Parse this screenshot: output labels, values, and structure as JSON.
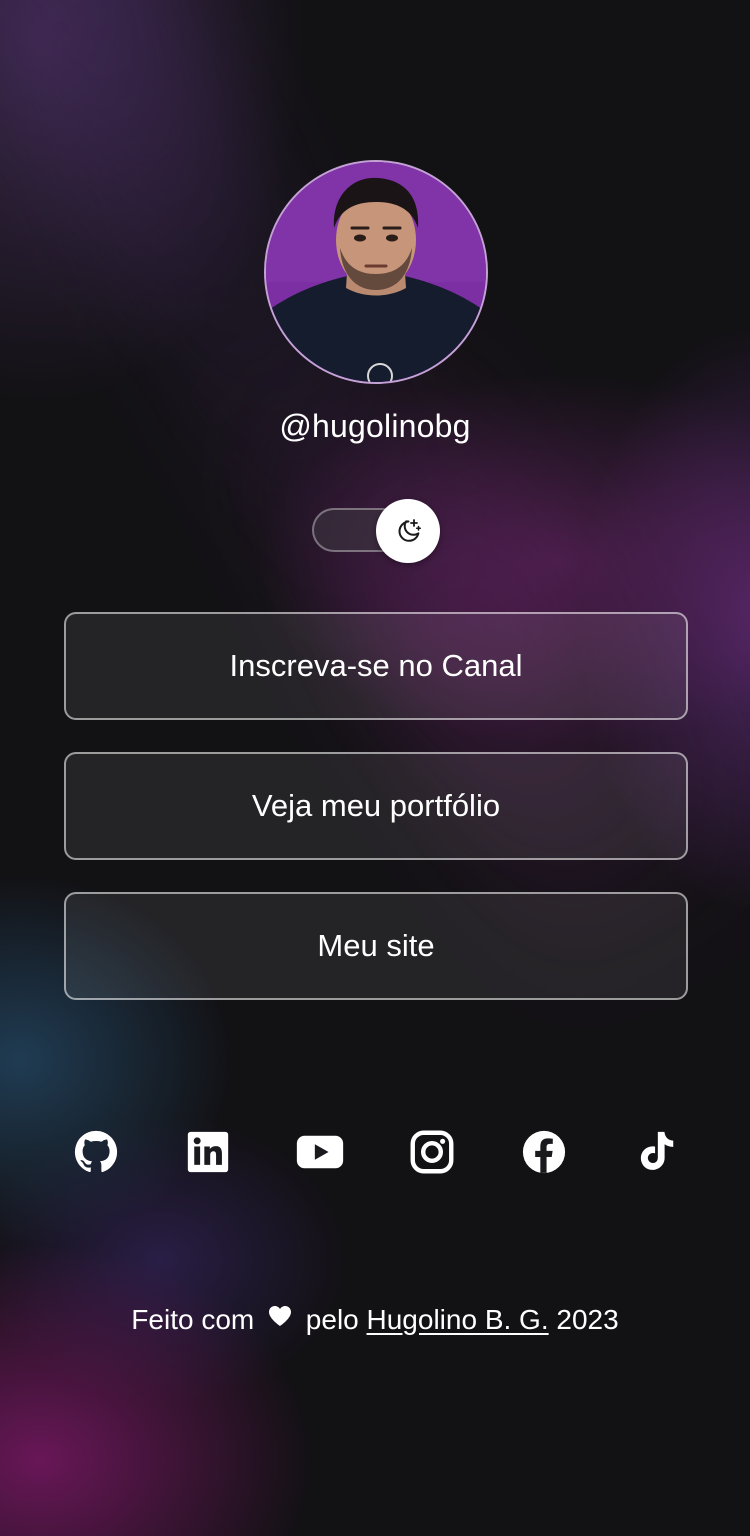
{
  "profile": {
    "username": "@hugolinobg"
  },
  "theme_toggle": {
    "icon": "moon-stars-icon"
  },
  "links": [
    {
      "label": "Inscreva-se no Canal"
    },
    {
      "label": "Veja meu portfólio"
    },
    {
      "label": "Meu site"
    }
  ],
  "social": [
    {
      "icon": "github-icon"
    },
    {
      "icon": "linkedin-icon"
    },
    {
      "icon": "youtube-icon"
    },
    {
      "icon": "instagram-icon"
    },
    {
      "icon": "facebook-icon"
    },
    {
      "icon": "tiktok-icon"
    }
  ],
  "footer": {
    "prefix": "Feito com",
    "middle": "pelo",
    "author": "Hugolino B. G.",
    "year": "2023"
  },
  "colors": {
    "background": "#121114",
    "text": "#ffffff",
    "avatar_bg": "#7b2fa2"
  }
}
